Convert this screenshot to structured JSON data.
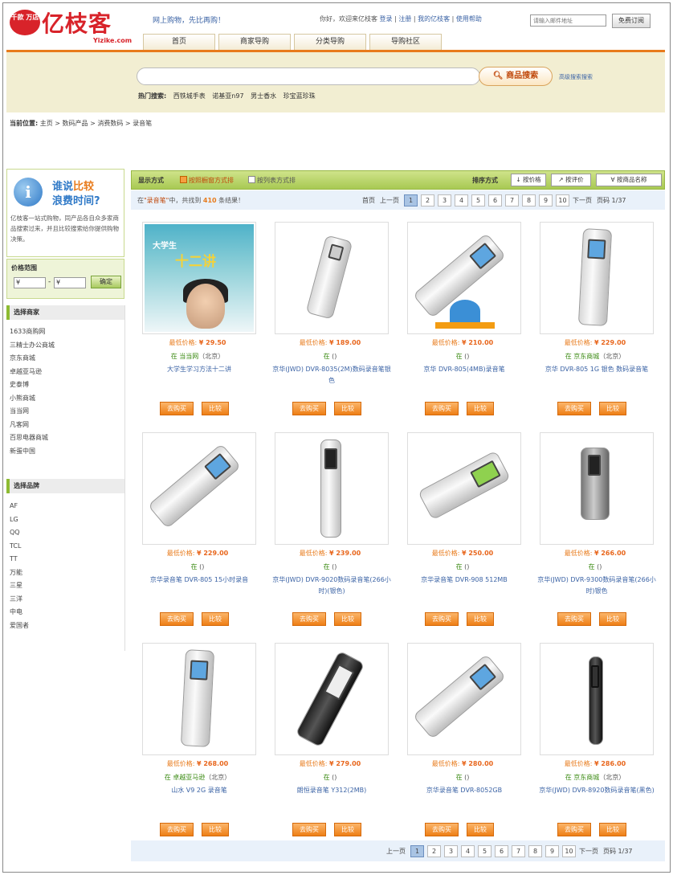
{
  "header": {
    "logo_badge": "千款\n万店",
    "logo_text": "亿枝客",
    "logo_url": "Yizike.com",
    "slogan": "网上购物，先比再购！",
    "greeting": "你好，欢迎来亿枝客",
    "links": [
      "登录",
      "注册",
      "我的亿枝客",
      "使用帮助"
    ],
    "subscribe_placeholder": "请输入邮件地址",
    "subscribe_button": "免费订阅"
  },
  "nav": [
    "首页",
    "商家导购",
    "分类导购",
    "导购社区"
  ],
  "search": {
    "placeholder": "",
    "button": "商品搜索",
    "advanced": "高级搜索搜索",
    "hot_label": "热门搜索:",
    "hot_terms": [
      "西铁城手表",
      "诺基亚n97",
      "男士香水",
      "珍宝蓝珍珠"
    ]
  },
  "breadcrumb": {
    "label": "当前位置:",
    "path": "主页 > 数码产品 > 消费数码 > 录音笔"
  },
  "sidebar": {
    "promo_title_1": "谁说",
    "promo_title_1b": "比较",
    "promo_title_2": "浪费时间?",
    "promo_desc": "亿枝客一站式购物，同产品各自众多家商品搜索过来，并且比较搜索给你提供购物决策。",
    "price_label": "价格范围",
    "price_from": "¥",
    "price_to": "¥",
    "price_button": "确定",
    "shops_title": "选择商家",
    "shops": [
      "1633商购网",
      "三精士办公商城",
      "京东商城",
      "卓越亚马逊",
      "史泰博",
      "小熊商城",
      "当当网",
      "凡客网",
      "百思电器商城",
      "新蛋中国"
    ],
    "brands_title": "选择品牌",
    "brands": [
      "AF",
      "LG",
      "QQ",
      "TCL",
      "TT",
      "万能",
      "三星",
      "三洋",
      "中电",
      "爱国者"
    ]
  },
  "toolbar": {
    "display_label": "显示方式",
    "view_grid": "按照橱窗方式排",
    "view_list": "按列表方式排",
    "sort_label": "排序方式",
    "sort_buttons": [
      "按价格",
      "按评价",
      "按商品名称"
    ]
  },
  "results": {
    "prefix": "在",
    "keyword": "\"录音笔\"",
    "middle": "中，共找到",
    "count": "410",
    "suffix": "条结果！"
  },
  "pager": {
    "first": "首页",
    "prev": "上一页",
    "pages": [
      "1",
      "2",
      "3",
      "4",
      "5",
      "6",
      "7",
      "8",
      "9",
      "10"
    ],
    "next": "下一页",
    "total": "页码 1/37",
    "total_bottom": "页码 1/37"
  },
  "products": [
    {
      "price": "¥ 29.50",
      "shop": "当当网",
      "shop_suffix": "（北京）",
      "name": "大学生学习方法十二讲",
      "kind": "book"
    },
    {
      "price": "¥ 189.00",
      "shop": "",
      "shop_suffix": "()",
      "name": "京华(JWD) DVR-8035(2M)数码录音笔银色",
      "kind": "slim"
    },
    {
      "price": "¥ 210.00",
      "shop": "",
      "shop_suffix": "()",
      "name": "京华 DVR-805(4MB)录音笔",
      "kind": "angled"
    },
    {
      "price": "¥ 229.00",
      "shop": "京东商城",
      "shop_suffix": "（北京）",
      "name": "京华 DVR-805 1G 银色 数码录音笔",
      "kind": "upright"
    },
    {
      "price": "¥ 229.00",
      "shop": "",
      "shop_suffix": "()",
      "name": "京华录音笔 DVR-805 15小时录音",
      "kind": "angled"
    },
    {
      "price": "¥ 239.00",
      "shop": "",
      "shop_suffix": "()",
      "name": "京华(JWD) DVR-9020数码录音笔(266小时)(银色)",
      "kind": "stick"
    },
    {
      "price": "¥ 250.00",
      "shop": "",
      "shop_suffix": "()",
      "name": "京华录音笔 DVR-908 512MB",
      "kind": "green"
    },
    {
      "price": "¥ 266.00",
      "shop": "",
      "shop_suffix": "()",
      "name": "京华(JWD) DVR-9300数码录音笔(266小时)银色",
      "kind": "stickdark"
    },
    {
      "price": "¥ 268.00",
      "shop": "卓越亚马逊",
      "shop_suffix": "（北京）",
      "name": "山水 V9 2G 录音笔",
      "kind": "upright2"
    },
    {
      "price": "¥ 279.00",
      "shop": "",
      "shop_suffix": "()",
      "name": "朗恒录音笔 Y312(2MB)",
      "kind": "black"
    },
    {
      "price": "¥ 280.00",
      "shop": "",
      "shop_suffix": "()",
      "name": "京华录音笔 DVR-8052GB",
      "kind": "angled"
    },
    {
      "price": "¥ 286.00",
      "shop": "京东商城",
      "shop_suffix": "（北京）",
      "name": "京华(JWD) DVR-8920数码录音笔(黑色)",
      "kind": "thinblack"
    }
  ],
  "product_labels": {
    "price_prefix": "最低价格:",
    "shop_prefix": "在",
    "buy": "去购买",
    "compare": "比较"
  },
  "colors": {
    "accent": "#e87b1c",
    "link": "#3b63a5",
    "brand": "#d8232a",
    "green": "#8dbb32"
  }
}
